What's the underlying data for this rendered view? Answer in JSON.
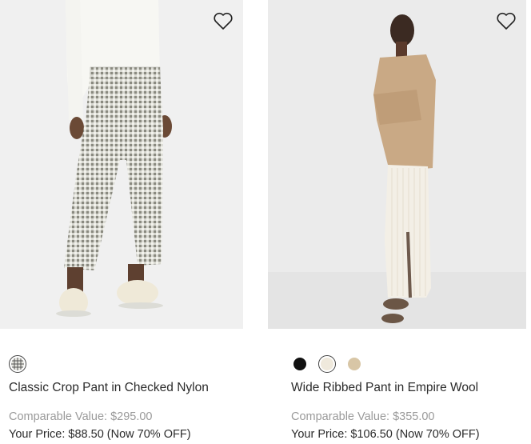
{
  "products": [
    {
      "name": "Classic Crop Pant in Checked Nylon",
      "comparable_value": "Comparable Value: $295.00",
      "your_price": "Your Price: $88.50 (Now 70% OFF)",
      "wishlist_icon": "heart-outline-icon",
      "swatches": [
        {
          "color": "#e6e6e0",
          "pattern": "check",
          "selected": true
        }
      ]
    },
    {
      "name": "Wide Ribbed Pant in Empire Wool",
      "comparable_value": "Comparable Value: $355.00",
      "your_price": "Your Price: $106.50 (Now 70% OFF)",
      "wishlist_icon": "heart-outline-icon",
      "swatches": [
        {
          "color": "#111111",
          "pattern": "solid",
          "selected": false
        },
        {
          "color": "#efe9dc",
          "pattern": "solid",
          "selected": true
        },
        {
          "color": "#d8c6a6",
          "pattern": "solid",
          "selected": false
        }
      ]
    }
  ]
}
